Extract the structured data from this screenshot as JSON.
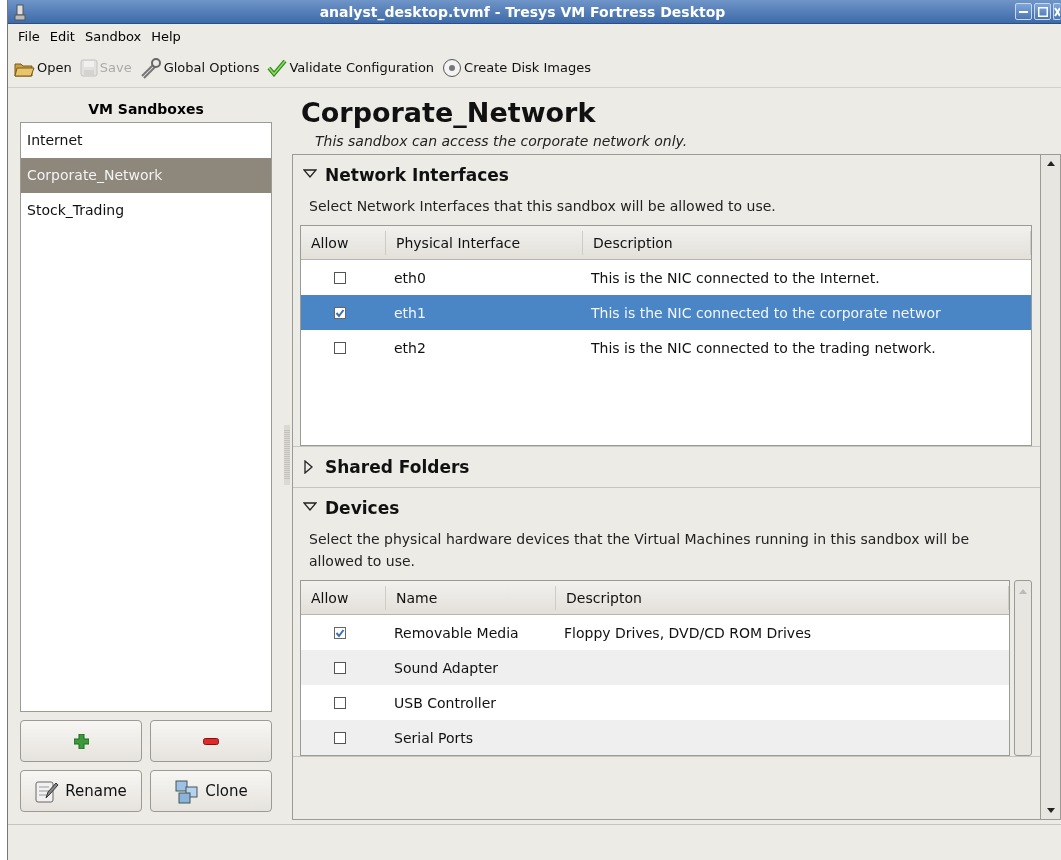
{
  "window": {
    "title": "analyst_desktop.tvmf - Tresys VM Fortress Desktop"
  },
  "menu": [
    "File",
    "Edit",
    "Sandbox",
    "Help"
  ],
  "toolbar": [
    {
      "label": "Open",
      "disabled": false
    },
    {
      "label": "Save",
      "disabled": true
    },
    {
      "label": "Global Options",
      "disabled": false
    },
    {
      "label": "Validate Configuration",
      "disabled": false
    },
    {
      "label": "Create Disk Images",
      "disabled": false
    }
  ],
  "sidebar": {
    "title": "VM Sandboxes",
    "items": [
      {
        "label": "Internet",
        "selected": false
      },
      {
        "label": "Corporate_Network",
        "selected": true
      },
      {
        "label": "Stock_Trading",
        "selected": false
      }
    ],
    "buttons": [
      "Rename",
      "Clone"
    ]
  },
  "detail": {
    "title": "Corporate_Network",
    "subtitle": "This sandbox can access the corporate network only.",
    "sections": [
      {
        "title": "Network Interfaces",
        "expanded": true,
        "description": "Select Network Interfaces that this sandbox will be allowed to use.",
        "table": {
          "columns": [
            "Allow",
            "Physical Interface",
            "Description"
          ],
          "rows": [
            {
              "checked": false,
              "selected": false,
              "cells": [
                "",
                "eth0",
                "This is the NIC connected to the Internet."
              ]
            },
            {
              "checked": true,
              "selected": true,
              "cells": [
                "",
                "eth1",
                "This is the NIC connected to the corporate networ"
              ]
            },
            {
              "checked": false,
              "selected": false,
              "cells": [
                "",
                "eth2",
                "This is the NIC connected to the trading network."
              ]
            }
          ]
        }
      },
      {
        "title": "Shared Folders",
        "expanded": false
      },
      {
        "title": "Devices",
        "expanded": true,
        "description": "Select the physical hardware devices that the Virtual Machines running in this sandbox will be allowed to use.",
        "table": {
          "columns": [
            "Allow",
            "Name",
            "Descripton"
          ],
          "rows": [
            {
              "checked": true,
              "selected": false,
              "cells": [
                "",
                "Removable Media",
                "Floppy Drives, DVD/CD ROM Drives"
              ]
            },
            {
              "checked": false,
              "selected": false,
              "cells": [
                "",
                "Sound Adapter"
              ]
            },
            {
              "checked": false,
              "selected": false,
              "cells": [
                "",
                "USB Controller"
              ]
            },
            {
              "checked": false,
              "selected": false,
              "cells": [
                "",
                "Serial Ports"
              ]
            }
          ]
        }
      }
    ]
  }
}
